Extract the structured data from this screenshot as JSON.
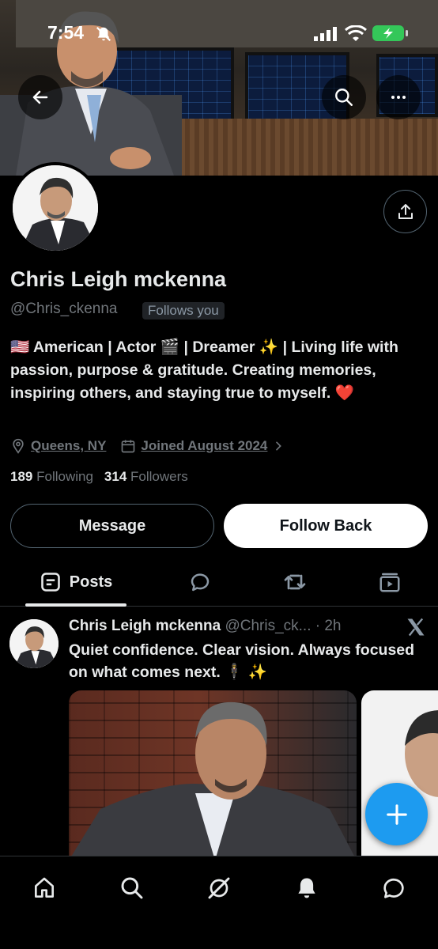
{
  "status_bar": {
    "time": "7:54"
  },
  "profile": {
    "display_name": "Chris Leigh mckenna",
    "handle": "@Chris_ckenna",
    "follows_you": "Follows you",
    "bio": "🇺🇸 American | Actor 🎬 | Dreamer ✨ | Living life with passion, purpose & gratitude. Creating memories, inspiring others, and staying true to myself. ❤️",
    "location": "Queens, NY",
    "joined": "Joined August 2024",
    "following_count": "189",
    "following_label": "Following",
    "followers_count": "314",
    "followers_label": "Followers"
  },
  "actions": {
    "message_label": "Message",
    "follow_back_label": "Follow Back"
  },
  "tabs": [
    {
      "label": "Posts",
      "icon": "posts-icon",
      "active": true
    },
    {
      "label": "",
      "icon": "replies-icon",
      "active": false
    },
    {
      "label": "",
      "icon": "repost-icon",
      "active": false
    },
    {
      "label": "",
      "icon": "media-icon",
      "active": false
    }
  ],
  "post": {
    "author": "Chris Leigh mckenna",
    "handle_time": "@Chris_ck... · 2h",
    "text": "Quiet confidence. Clear vision. Always focused on what comes next. 🕴️ ✨"
  },
  "nav": [
    "home-icon",
    "search-icon",
    "grok-icon",
    "notifications-icon",
    "messages-icon"
  ],
  "colors": {
    "accent": "#1d9bf0",
    "background": "#000000",
    "muted": "#71767b",
    "battery": "#34c759"
  }
}
